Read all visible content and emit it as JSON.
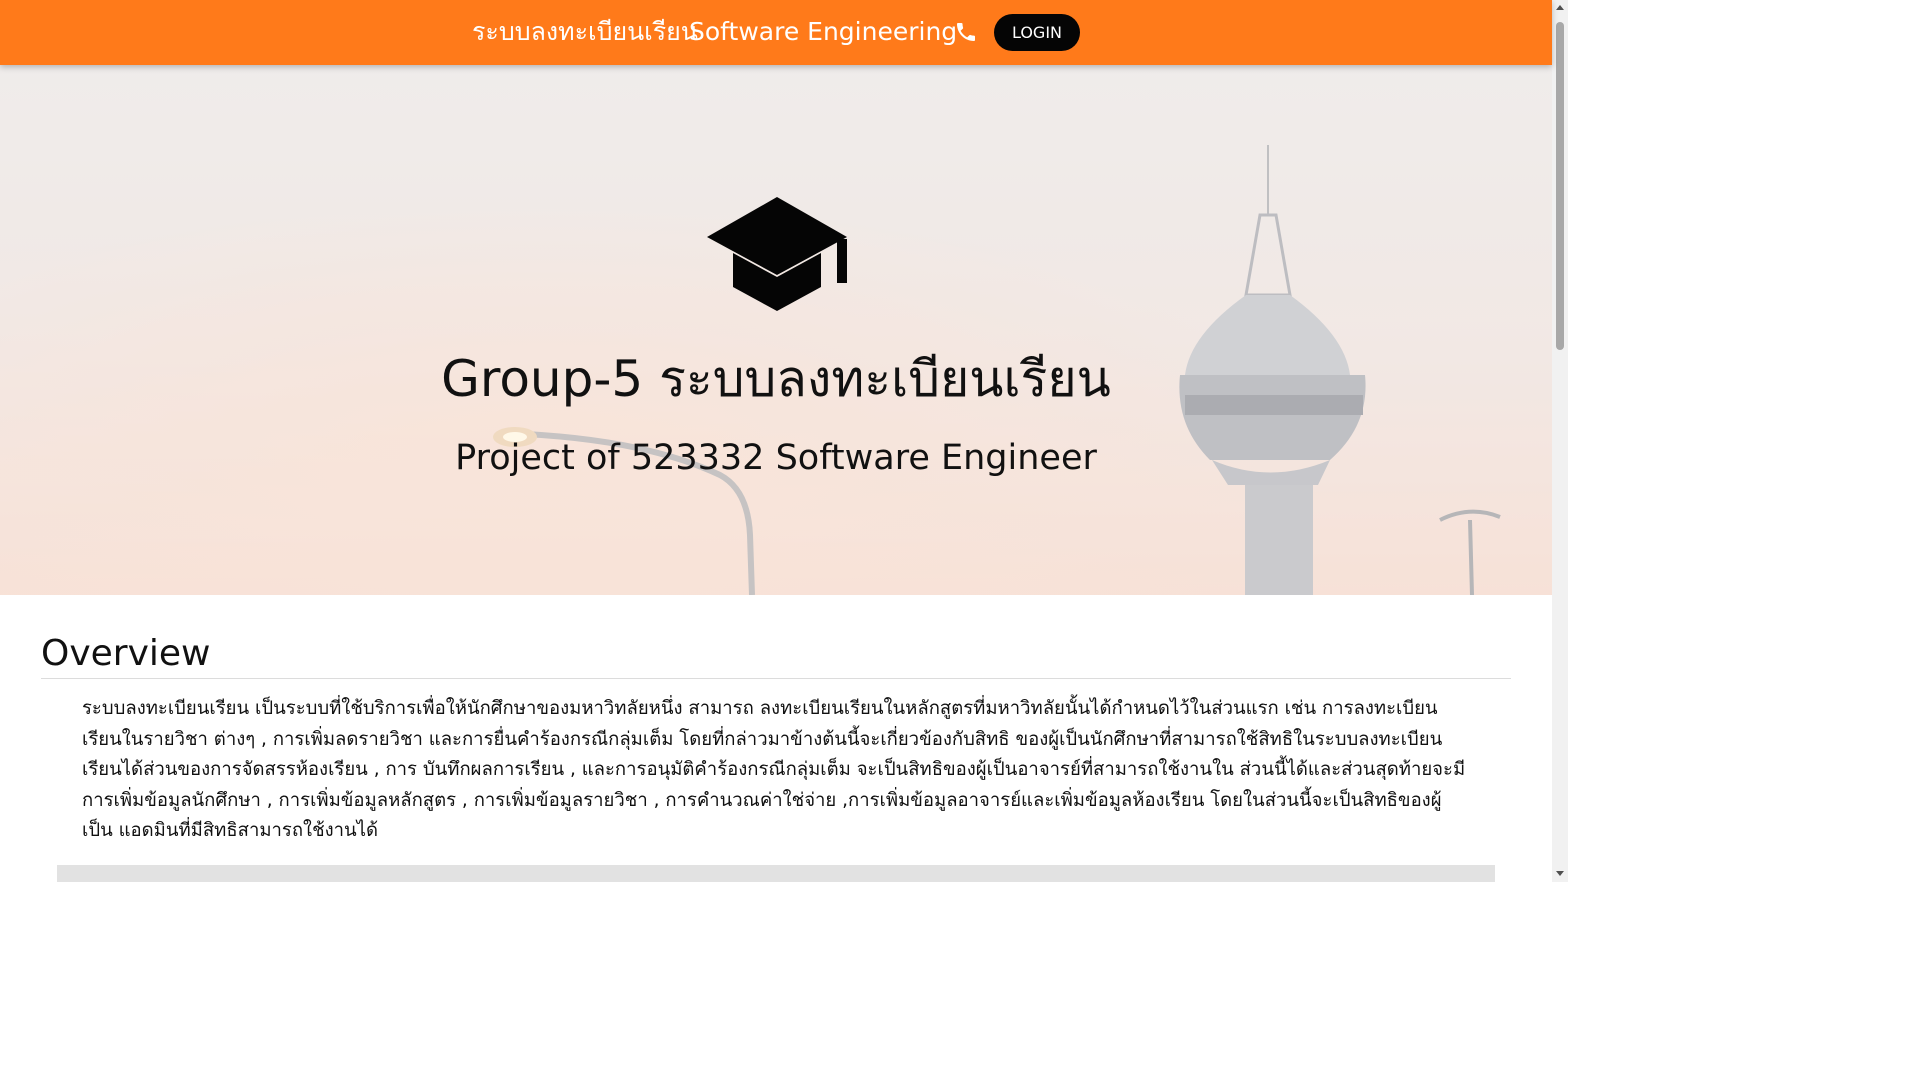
{
  "navbar": {
    "brand": "ระบบลงทะเบียนเรียน",
    "course": "Software Engineering",
    "phone_icon": "phone-icon",
    "login_label": "LOGIN",
    "background_color": "#ff7a1a"
  },
  "hero": {
    "icon": "graduation-cap-icon",
    "title": "Group-5 ระบบลงทะเบียนเรียน",
    "subtitle": "Project of 523332 Software Engineer"
  },
  "overview": {
    "heading": "Overview",
    "body": "ระบบลงทะเบียนเรียน เป็นระบบที่ใช้บริการเพื่อให้นักศึกษาของมหาวิทลัยหนึ่ง สามารถ ลงทะเบียนเรียนในหลักสูตรที่มหาวิทลัยนั้นได้กำหนดไว้ในส่วนแรก เช่น การลงทะเบียนเรียนในรายวิชา ต่างๆ , การเพิ่มลดรายวิชา และการยื่นคำร้องกรณีกลุ่มเต็ม โดยที่กล่าวมาข้างต้นนี้จะเกี่ยวข้องกับสิทธิ ของผู้เป็นนักศึกษาที่สามารถใช้สิทธิในระบบลงทะเบียนเรียนได้ส่วนของการจัดสรรห้องเรียน , การ บันทึกผลการเรียน , และการอนุมัติคำร้องกรณีกลุ่มเต็ม จะเป็นสิทธิของผู้เป็นอาจารย์ที่สามารถใช้งานใน ส่วนนี้ได้และส่วนสุดท้ายจะมีการเพิ่มข้อมูลนักศึกษา , การเพิ่มข้อมูลหลักสูตร , การเพิ่มข้อมูลรายวิชา , การคำนวณค่าใช่จ่าย ,การเพิ่มข้อมูลอาจารย์และเพิ่มข้อมูลห้องเรียน โดยในส่วนนี้จะเป็นสิทธิของผู้เป็น แอดมินที่มีสิทธิสามารถใช้งานได้"
  }
}
